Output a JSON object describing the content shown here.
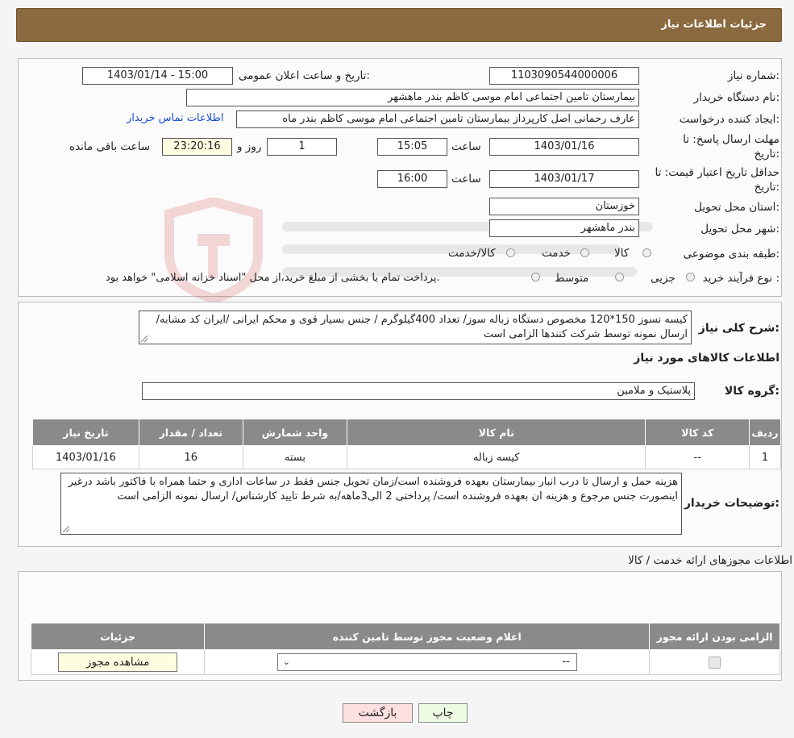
{
  "header": {
    "title": "جزئیات اطلاعات نیاز"
  },
  "form": {
    "need_number_label": "شماره نیاز:",
    "need_number": "1103090544000006",
    "announce_label": "تاریخ و ساعت اعلان عمومی:",
    "announce_value": "1403/01/14 - 15:00",
    "buyer_org_label": "نام دستگاه خریدار:",
    "buyer_org": "بیمارستان تامین اجتماعی امام موسی کاظم بندر ماهشهر",
    "requester_label": "ایجاد کننده درخواست:",
    "requester": "عارف رحمانی اصل کارپرداز بیمارستان تامین اجتماعی امام موسی کاظم بندر ماه",
    "contact_link": "اطلاعات تماس خریدار",
    "reply_deadline_label_1": "مهلت ارسال پاسخ: تا",
    "reply_deadline_label_2": "تاریخ:",
    "reply_date": "1403/01/16",
    "time_label": "ساعت",
    "reply_time": "15:05",
    "days": "1",
    "days_label": "روز و",
    "remaining": "23:20:16",
    "remaining_label": "ساعت باقی مانده",
    "price_validity_label_1": "حداقل تاریخ اعتبار قیمت: تا",
    "price_validity_label_2": "تاریخ:",
    "validity_date": "1403/01/17",
    "validity_time": "16:00",
    "province_label": "استان محل تحویل:",
    "province": "خوزستان",
    "city_label": "شهر محل تحویل:",
    "city": "بندر ماهشهر",
    "category_label": "طبقه بندی موضوعی:",
    "category_options": [
      "کالا",
      "خدمت",
      "کالا/خدمت"
    ],
    "process_label": "نوع فرآیند خرید :",
    "process_options": [
      "جزیی",
      "متوسط"
    ],
    "process_note": "پرداخت تمام یا بخشی از مبلغ خرید،از محل \"اسناد خزانه اسلامی\" خواهد بود."
  },
  "desc": {
    "summary_label": "شرح کلی نیاز:",
    "summary": "کیسه نسوز 150*120 مخصوص دستگاه زباله سوز/ تعداد 400گیلوگرم / جنس بسیار قوی و محکم ایرانی /ایران کد مشابه/ارسال نمونه توسط شرکت کنندها الزامی است",
    "goods_info_title": "اطلاعات کالاهای مورد نیاز",
    "group_label": "گروه کالا:",
    "group_value": "پلاستیک و ملامین",
    "table": {
      "headers": [
        "ردیف",
        "کد کالا",
        "نام کالا",
        "واحد شمارش",
        "تعداد / مقدار",
        "تاریخ نیاز"
      ],
      "rows": [
        [
          "1",
          "--",
          "کیسه زباله",
          "بسته",
          "16",
          "1403/01/16"
        ]
      ]
    },
    "buyer_notes_label": "توضیحات خریدار:",
    "buyer_notes": "هزینه حمل و ارسال تا درب انبار بیمارستان بعهده فروشنده است/زمان تحویل جنس فقط در ساعات اداری و حتما همراه با فاکتور باشد درغیر اینصورت جنس مرجوع و هزینه ان بعهده فروشنده است/ پرداختی 2 الی3ماهه/به شرط تایید کارشناس/ ارسال نمونه الزامی است"
  },
  "permits": {
    "title": "اطلاعات مجوزهای ارائه خدمت / کالا",
    "headers": [
      "الزامی بودن ارائه مجوز",
      "اعلام وضعیت مجوز توسط تامین کننده",
      "جزئیات"
    ],
    "select_value": "--",
    "view_button": "مشاهده مجوز"
  },
  "buttons": {
    "print": "چاپ",
    "back": "بازگشت"
  },
  "colors": {
    "header_bg": "#8b6a3f",
    "table_header_bg": "#8a8a8a",
    "back_button_bg": "#fde0e0",
    "print_button_bg": "#eefbe4"
  }
}
